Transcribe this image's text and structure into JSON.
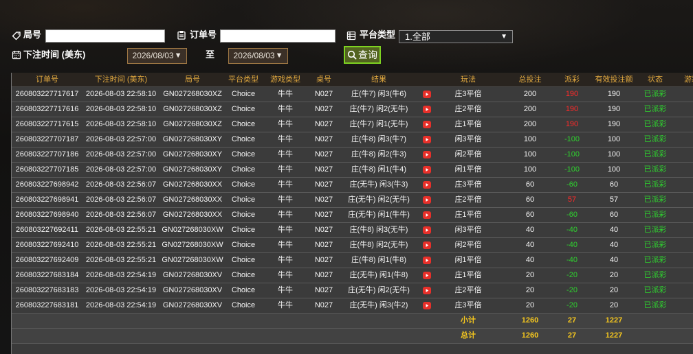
{
  "filters": {
    "round": {
      "label": "局号",
      "value": ""
    },
    "order": {
      "label": "订单号",
      "value": ""
    },
    "platform": {
      "label": "平台类型",
      "selected": "1.全部"
    },
    "bet_time": {
      "label": "下注时间 (美东)",
      "from": "2026/08/03",
      "to_label": "至",
      "to": "2026/08/03"
    },
    "query_button": "查询"
  },
  "icons": {
    "round": "tag-icon",
    "order": "clipboard-icon",
    "platform": "list-icon",
    "bet_time": "calendar-icon",
    "query": "search-icon",
    "dropdown": "chevron-down-icon",
    "replay": "play-video-icon"
  },
  "colors": {
    "header_text": "#e2a93f",
    "payout_positive": "#ff2a2a",
    "payout_negative": "#2fd12f",
    "status_paid": "#2fd12f",
    "summary_text": "#f7c81e",
    "query_border": "#7ed321"
  },
  "table": {
    "headers": {
      "order": "订单号",
      "time": "下注时间 (美东)",
      "round": "局号",
      "platform": "平台类型",
      "game": "游戏类型",
      "table_no": "桌号",
      "result": "结果",
      "play": "玩法",
      "bet": "总投注",
      "payout": "派彩",
      "valid_bet": "有效投注额",
      "status": "状态",
      "extra": "游彩"
    },
    "rows": [
      {
        "order": "260803227717617",
        "time": "2026-08-03 22:58:10",
        "round": "GN027268030XZ",
        "platform": "Choice",
        "game": "牛牛",
        "table_no": "N027",
        "result": "庄(牛7) 闲3(牛6)",
        "play": "庄3平倍",
        "bet": "200",
        "payout": "190",
        "valid_bet": "190",
        "status": "已派彩"
      },
      {
        "order": "260803227717616",
        "time": "2026-08-03 22:58:10",
        "round": "GN027268030XZ",
        "platform": "Choice",
        "game": "牛牛",
        "table_no": "N027",
        "result": "庄(牛7) 闲2(无牛)",
        "play": "庄2平倍",
        "bet": "200",
        "payout": "190",
        "valid_bet": "190",
        "status": "已派彩"
      },
      {
        "order": "260803227717615",
        "time": "2026-08-03 22:58:10",
        "round": "GN027268030XZ",
        "platform": "Choice",
        "game": "牛牛",
        "table_no": "N027",
        "result": "庄(牛7) 闲1(无牛)",
        "play": "庄1平倍",
        "bet": "200",
        "payout": "190",
        "valid_bet": "190",
        "status": "已派彩"
      },
      {
        "order": "260803227707187",
        "time": "2026-08-03 22:57:00",
        "round": "GN027268030XY",
        "platform": "Choice",
        "game": "牛牛",
        "table_no": "N027",
        "result": "庄(牛8) 闲3(牛7)",
        "play": "闲3平倍",
        "bet": "100",
        "payout": "-100",
        "valid_bet": "100",
        "status": "已派彩"
      },
      {
        "order": "260803227707186",
        "time": "2026-08-03 22:57:00",
        "round": "GN027268030XY",
        "platform": "Choice",
        "game": "牛牛",
        "table_no": "N027",
        "result": "庄(牛8) 闲2(牛3)",
        "play": "闲2平倍",
        "bet": "100",
        "payout": "-100",
        "valid_bet": "100",
        "status": "已派彩"
      },
      {
        "order": "260803227707185",
        "time": "2026-08-03 22:57:00",
        "round": "GN027268030XY",
        "platform": "Choice",
        "game": "牛牛",
        "table_no": "N027",
        "result": "庄(牛8) 闲1(牛4)",
        "play": "闲1平倍",
        "bet": "100",
        "payout": "-100",
        "valid_bet": "100",
        "status": "已派彩"
      },
      {
        "order": "260803227698942",
        "time": "2026-08-03 22:56:07",
        "round": "GN027268030XX",
        "platform": "Choice",
        "game": "牛牛",
        "table_no": "N027",
        "result": "庄(无牛) 闲3(牛3)",
        "play": "庄3平倍",
        "bet": "60",
        "payout": "-60",
        "valid_bet": "60",
        "status": "已派彩"
      },
      {
        "order": "260803227698941",
        "time": "2026-08-03 22:56:07",
        "round": "GN027268030XX",
        "platform": "Choice",
        "game": "牛牛",
        "table_no": "N027",
        "result": "庄(无牛) 闲2(无牛)",
        "play": "庄2平倍",
        "bet": "60",
        "payout": "57",
        "valid_bet": "57",
        "status": "已派彩"
      },
      {
        "order": "260803227698940",
        "time": "2026-08-03 22:56:07",
        "round": "GN027268030XX",
        "platform": "Choice",
        "game": "牛牛",
        "table_no": "N027",
        "result": "庄(无牛) 闲1(牛牛)",
        "play": "庄1平倍",
        "bet": "60",
        "payout": "-60",
        "valid_bet": "60",
        "status": "已派彩"
      },
      {
        "order": "260803227692411",
        "time": "2026-08-03 22:55:21",
        "round": "GN027268030XW",
        "platform": "Choice",
        "game": "牛牛",
        "table_no": "N027",
        "result": "庄(牛8) 闲3(无牛)",
        "play": "闲3平倍",
        "bet": "40",
        "payout": "-40",
        "valid_bet": "40",
        "status": "已派彩"
      },
      {
        "order": "260803227692410",
        "time": "2026-08-03 22:55:21",
        "round": "GN027268030XW",
        "platform": "Choice",
        "game": "牛牛",
        "table_no": "N027",
        "result": "庄(牛8) 闲2(无牛)",
        "play": "闲2平倍",
        "bet": "40",
        "payout": "-40",
        "valid_bet": "40",
        "status": "已派彩"
      },
      {
        "order": "260803227692409",
        "time": "2026-08-03 22:55:21",
        "round": "GN027268030XW",
        "platform": "Choice",
        "game": "牛牛",
        "table_no": "N027",
        "result": "庄(牛8) 闲1(牛8)",
        "play": "闲1平倍",
        "bet": "40",
        "payout": "-40",
        "valid_bet": "40",
        "status": "已派彩"
      },
      {
        "order": "260803227683184",
        "time": "2026-08-03 22:54:19",
        "round": "GN027268030XV",
        "platform": "Choice",
        "game": "牛牛",
        "table_no": "N027",
        "result": "庄(无牛) 闲1(牛8)",
        "play": "庄1平倍",
        "bet": "20",
        "payout": "-20",
        "valid_bet": "20",
        "status": "已派彩"
      },
      {
        "order": "260803227683183",
        "time": "2026-08-03 22:54:19",
        "round": "GN027268030XV",
        "platform": "Choice",
        "game": "牛牛",
        "table_no": "N027",
        "result": "庄(无牛) 闲2(无牛)",
        "play": "庄2平倍",
        "bet": "20",
        "payout": "-20",
        "valid_bet": "20",
        "status": "已派彩"
      },
      {
        "order": "260803227683181",
        "time": "2026-08-03 22:54:19",
        "round": "GN027268030XV",
        "platform": "Choice",
        "game": "牛牛",
        "table_no": "N027",
        "result": "庄(无牛) 闲3(牛2)",
        "play": "庄3平倍",
        "bet": "20",
        "payout": "-20",
        "valid_bet": "20",
        "status": "已派彩"
      }
    ],
    "subtotal": {
      "label": "小计",
      "bet": "1260",
      "payout": "27",
      "valid_bet": "1227"
    },
    "total": {
      "label": "总计",
      "bet": "1260",
      "payout": "27",
      "valid_bet": "1227"
    }
  }
}
